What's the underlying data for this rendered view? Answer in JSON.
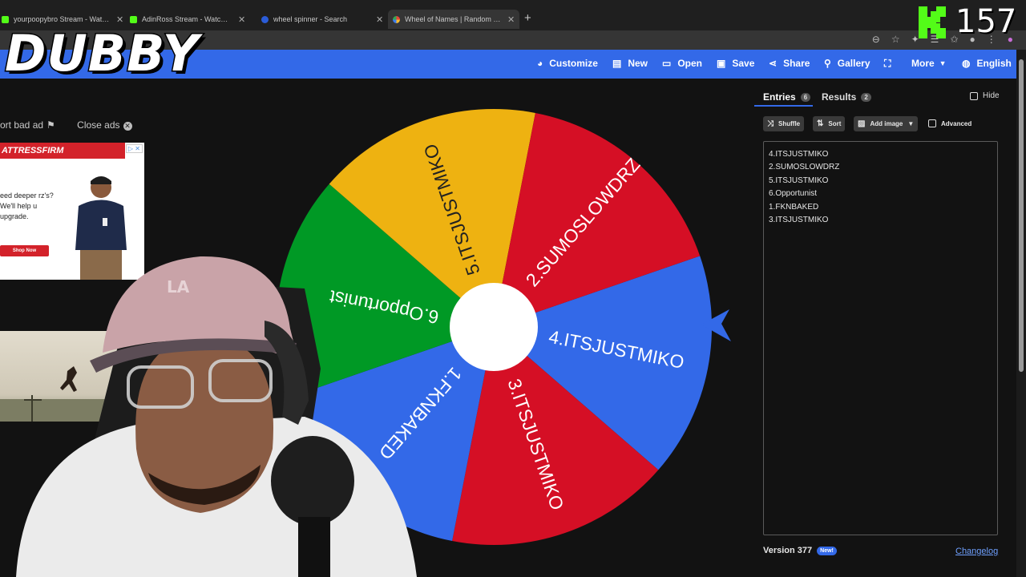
{
  "browser": {
    "tabs": [
      {
        "title": "yourpoopybro Stream - Watch Liv",
        "favicon_color": "#53fc18"
      },
      {
        "title": "AdinRoss Stream - Watch Live",
        "favicon_color": "#53fc18"
      },
      {
        "title": "wheel spinner - Search",
        "favicon_color": "#2b5cd8"
      },
      {
        "title": "Wheel of Names | Random name",
        "favicon_color": "#e8453c"
      }
    ],
    "new_tab_label": "+"
  },
  "overlay": {
    "streamer_name": "DUBBY",
    "viewer_count": "157",
    "kick_color": "#53fc18"
  },
  "toolbar": {
    "accent": "#3369e8",
    "items": [
      {
        "label": "Customize",
        "icon": "palette-icon"
      },
      {
        "label": "New",
        "icon": "file-icon"
      },
      {
        "label": "Open",
        "icon": "folder-icon"
      },
      {
        "label": "Save",
        "icon": "save-icon"
      },
      {
        "label": "Share",
        "icon": "share-icon"
      },
      {
        "label": "Gallery",
        "icon": "search-icon"
      },
      {
        "label": "",
        "icon": "fullscreen-icon"
      },
      {
        "label": "More",
        "icon": "chevron-down-icon"
      },
      {
        "label": "English",
        "icon": "globe-icon"
      }
    ]
  },
  "ads": {
    "report_label": "ort bad ad",
    "close_label": "Close ads",
    "banner_brand": "ATTRESSFIRM",
    "banner_text": "eed deeper rz's? We'll help u upgrade.",
    "banner_cta": "Shop Now"
  },
  "wheel": {
    "segments": [
      {
        "label": "4.ITSJUSTMIKO",
        "color": "#3369e8"
      },
      {
        "label": "3.ITSJUSTMIKO",
        "color": "#d50f25"
      },
      {
        "label": "1.FKNBAKED",
        "color": "#3369e8"
      },
      {
        "label": "6.Opportunist",
        "color": "#009925"
      },
      {
        "label": "5.ITSJUSTMIKO",
        "color": "#eeb211"
      },
      {
        "label": "2.SUMOSLOWDRZ",
        "color": "#d50f25"
      }
    ],
    "center_color": "#ffffff",
    "pointer_color": "#3369e8"
  },
  "panel": {
    "tab_entries": "Entries",
    "entries_count": "6",
    "tab_results": "Results",
    "results_count": "2",
    "hide_label": "Hide",
    "shuffle_label": "Shuffle",
    "sort_label": "Sort",
    "add_image_label": "Add image",
    "advanced_label": "Advanced",
    "entries": [
      "4.ITSJUSTMIKO",
      "2.SUMOSLOWDRZ",
      "5.ITSJUSTMIKO",
      "6.Opportunist",
      "1.FKNBAKED",
      "3.ITSJUSTMIKO"
    ],
    "version": "Version 377",
    "new_badge": "New!",
    "changelog": "Changelog"
  }
}
